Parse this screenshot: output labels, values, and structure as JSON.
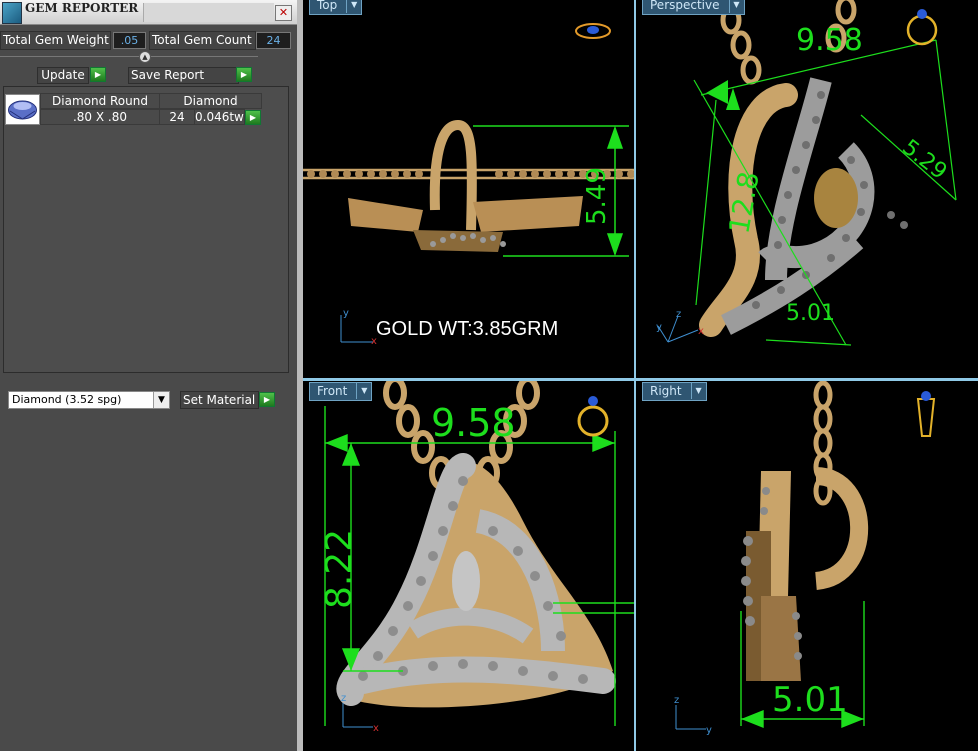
{
  "panel": {
    "title": "GEM REPORTER",
    "close_label": "✕",
    "total_weight_label": "Total Gem Weight",
    "total_weight_value": ".05",
    "total_count_label": "Total Gem Count",
    "total_count_value": "24",
    "collapse_label": "▲",
    "update_label": "Update",
    "save_report_label": "Save Report",
    "gem_table": {
      "row": {
        "shape": "Diamond Round",
        "type": "Diamond",
        "size": ".80 X .80",
        "count": "24",
        "weight": "0.046tw"
      }
    },
    "material_select_value": "Diamond     (3.52 spg)",
    "set_material_label": "Set Material"
  },
  "viewports": {
    "top": {
      "tab": "Top",
      "annotation": "GOLD WT:3.85GRM",
      "dimension": "5.49"
    },
    "persp": {
      "tab": "Perspective",
      "dimensions": [
        "9.58",
        "12.8",
        "5.29",
        "5.01"
      ]
    },
    "front": {
      "tab": "Front",
      "dimensions": [
        "9.58",
        "8.22"
      ]
    },
    "right": {
      "tab": "Right",
      "dimensions": [
        "5.01"
      ]
    }
  },
  "colors": {
    "metal": "#c9a46a",
    "dimension_lines": "#1dde1d",
    "gem": "#a8a8a8",
    "viewport_border": "#8fc9e6"
  }
}
